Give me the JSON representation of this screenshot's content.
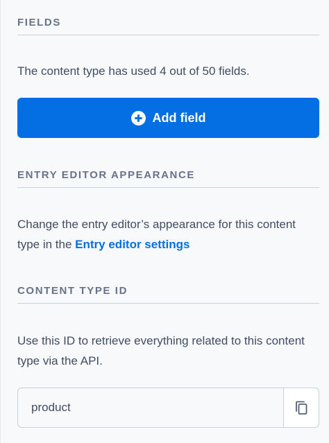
{
  "fields": {
    "title": "FIELDS",
    "description": "The content type has used 4 out of 50 fields.",
    "add_button_label": "Add field"
  },
  "entry_editor": {
    "title": "ENTRY EDITOR APPEARANCE",
    "description": "Change the entry editor’s appearance for this content type in the ",
    "link_label": "Entry editor settings"
  },
  "content_type_id": {
    "title": "CONTENT TYPE ID",
    "description": "Use this ID to retrieve everything related to this content type via the API.",
    "value": "product"
  },
  "icons": {
    "add": "plus-circle-icon",
    "copy": "copy-icon"
  },
  "colors": {
    "primary": "#036fe3",
    "text": "#414d63",
    "heading": "#67728a",
    "border": "#c5d2d8",
    "background": "#f7f9fa"
  }
}
